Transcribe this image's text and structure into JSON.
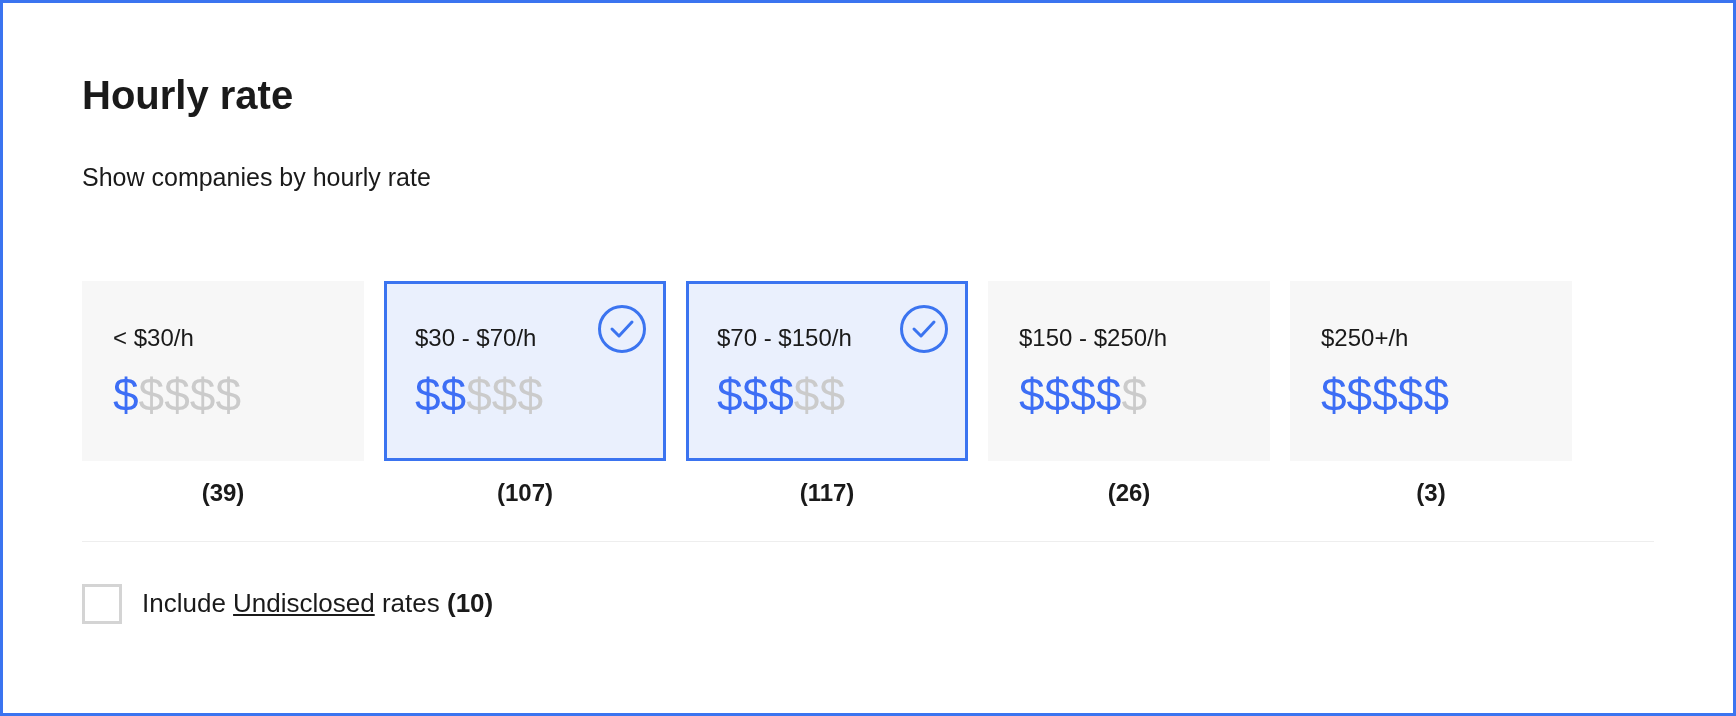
{
  "title": "Hourly rate",
  "subtitle": "Show companies by hourly rate",
  "rates": [
    {
      "label": "< $30/h",
      "signs": [
        {
          "symbol": "$",
          "on": true
        },
        {
          "symbol": "$",
          "on": false
        },
        {
          "symbol": "$",
          "on": false
        },
        {
          "symbol": "$",
          "on": false
        },
        {
          "symbol": "$",
          "on": false
        }
      ],
      "count": "(39)",
      "selected": false
    },
    {
      "label": "$30 - $70/h",
      "signs": [
        {
          "symbol": "$",
          "on": true
        },
        {
          "symbol": "$",
          "on": true
        },
        {
          "symbol": "$",
          "on": false
        },
        {
          "symbol": "$",
          "on": false
        },
        {
          "symbol": "$",
          "on": false
        }
      ],
      "count": "(107)",
      "selected": true
    },
    {
      "label": "$70 - $150/h",
      "signs": [
        {
          "symbol": "$",
          "on": true
        },
        {
          "symbol": "$",
          "on": true
        },
        {
          "symbol": "$",
          "on": true
        },
        {
          "symbol": "$",
          "on": false
        },
        {
          "symbol": "$",
          "on": false
        }
      ],
      "count": "(117)",
      "selected": true
    },
    {
      "label": "$150 - $250/h",
      "signs": [
        {
          "symbol": "$",
          "on": true
        },
        {
          "symbol": "$",
          "on": true
        },
        {
          "symbol": "$",
          "on": true
        },
        {
          "symbol": "$",
          "on": true
        },
        {
          "symbol": "$",
          "on": false
        }
      ],
      "count": "(26)",
      "selected": false
    },
    {
      "label": "$250+/h",
      "signs": [
        {
          "symbol": "$",
          "on": true
        },
        {
          "symbol": "$",
          "on": true
        },
        {
          "symbol": "$",
          "on": true
        },
        {
          "symbol": "$",
          "on": true
        },
        {
          "symbol": "$",
          "on": true
        }
      ],
      "count": "(3)",
      "selected": false
    }
  ],
  "undisclosed": {
    "checked": false,
    "prefix": "Include",
    "link": "Undisclosed",
    "suffix": "rates **(10)**"
  }
}
